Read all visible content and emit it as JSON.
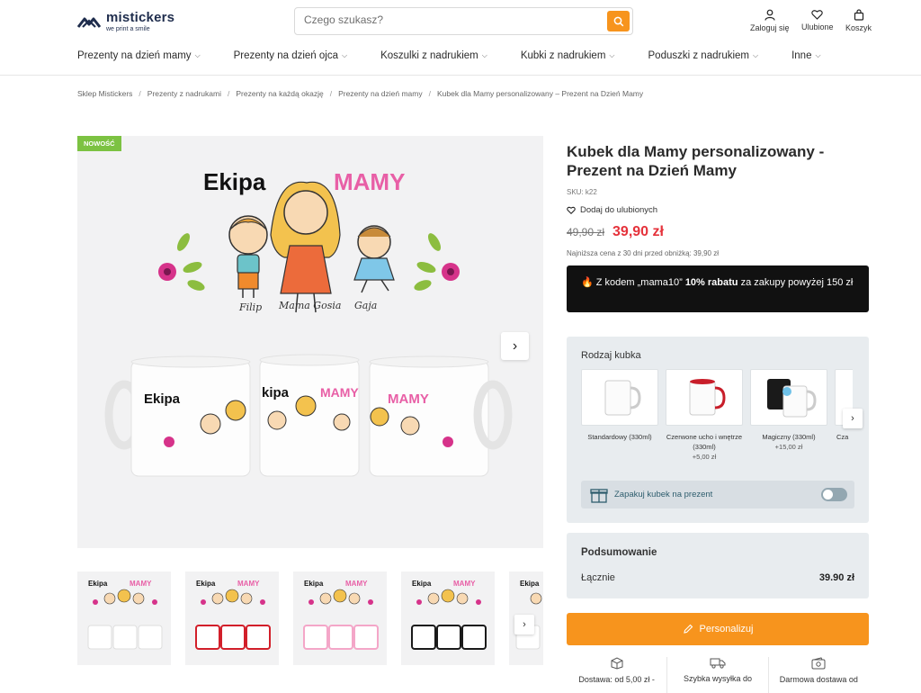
{
  "header": {
    "logo": {
      "name": "mistickers",
      "tagline": "we print a smile"
    },
    "search": {
      "placeholder": "Czego szukasz?"
    },
    "actions": [
      {
        "label": "Zaloguj się",
        "icon": "user-icon"
      },
      {
        "label": "Ulubione",
        "icon": "heart-icon"
      },
      {
        "label": "Koszyk",
        "icon": "cart-icon"
      }
    ]
  },
  "nav": [
    {
      "label": "Prezenty na dzień mamy"
    },
    {
      "label": "Prezenty na dzień ojca"
    },
    {
      "label": "Koszulki z nadrukiem"
    },
    {
      "label": "Kubki z nadrukiem"
    },
    {
      "label": "Poduszki z nadrukiem"
    },
    {
      "label": "Inne"
    }
  ],
  "breadcrumb": [
    "Sklep Mistickers",
    "Prezenty z nadrukami",
    "Prezenty na każdą okazję",
    "Prezenty na dzień mamy",
    "Kubek dla Mamy personalizowany – Prezent na Dzień Mamy"
  ],
  "gallery": {
    "badge": "NOWOŚĆ",
    "image": {
      "headline_left": "Ekipa",
      "headline_right": "MAMY",
      "names": [
        "Filip",
        "Mama Gosia",
        "Gaja"
      ],
      "mug_texts": [
        "Ekipa",
        "kipa",
        "MAMY",
        "MAMY"
      ]
    },
    "thumb_colors": [
      "#ffffff",
      "#d21f2a",
      "#f4a6c8",
      "#1a1a1a",
      "#ffffff"
    ]
  },
  "product": {
    "title": "Kubek dla Mamy personalizowany - Prezent na Dzień Mamy",
    "sku": "SKU: k22",
    "favorite_label": "Dodaj do ulubionych",
    "price_old": "49,90 zł",
    "price_new": "39,90 zł",
    "lowest_price": "Najniższa cena z 30 dni przed obniżką: 39,90 zł",
    "promo": {
      "icon": "fire-icon",
      "prefix": "Z kodem „mama10”",
      "bold": "10% rabatu",
      "suffix": "za zakupy powyżej 150 zł"
    }
  },
  "variants": {
    "title": "Rodzaj kubka",
    "items": [
      {
        "label": "Standardowy (330ml)",
        "price": ""
      },
      {
        "label": "Czerwone ucho i wnętrze (330ml)",
        "price": "+5,00 zł"
      },
      {
        "label": "Magiczny (330ml)",
        "price": "+15,00 zł"
      },
      {
        "label": "Cza",
        "price": ""
      }
    ],
    "gift_label": "Zapakuj kubek na prezent"
  },
  "summary": {
    "title": "Podsumowanie",
    "total_label": "Łącznie",
    "total_value": "39.90 zł"
  },
  "cta": {
    "label": "Personalizuj"
  },
  "benefits": [
    {
      "label": "Dostawa: od 5,00 zł -",
      "icon": "box-icon"
    },
    {
      "label": "Szybka wysyłka do",
      "icon": "truck-icon"
    },
    {
      "label": "Darmowa dostawa od",
      "icon": "wallet-icon"
    }
  ]
}
